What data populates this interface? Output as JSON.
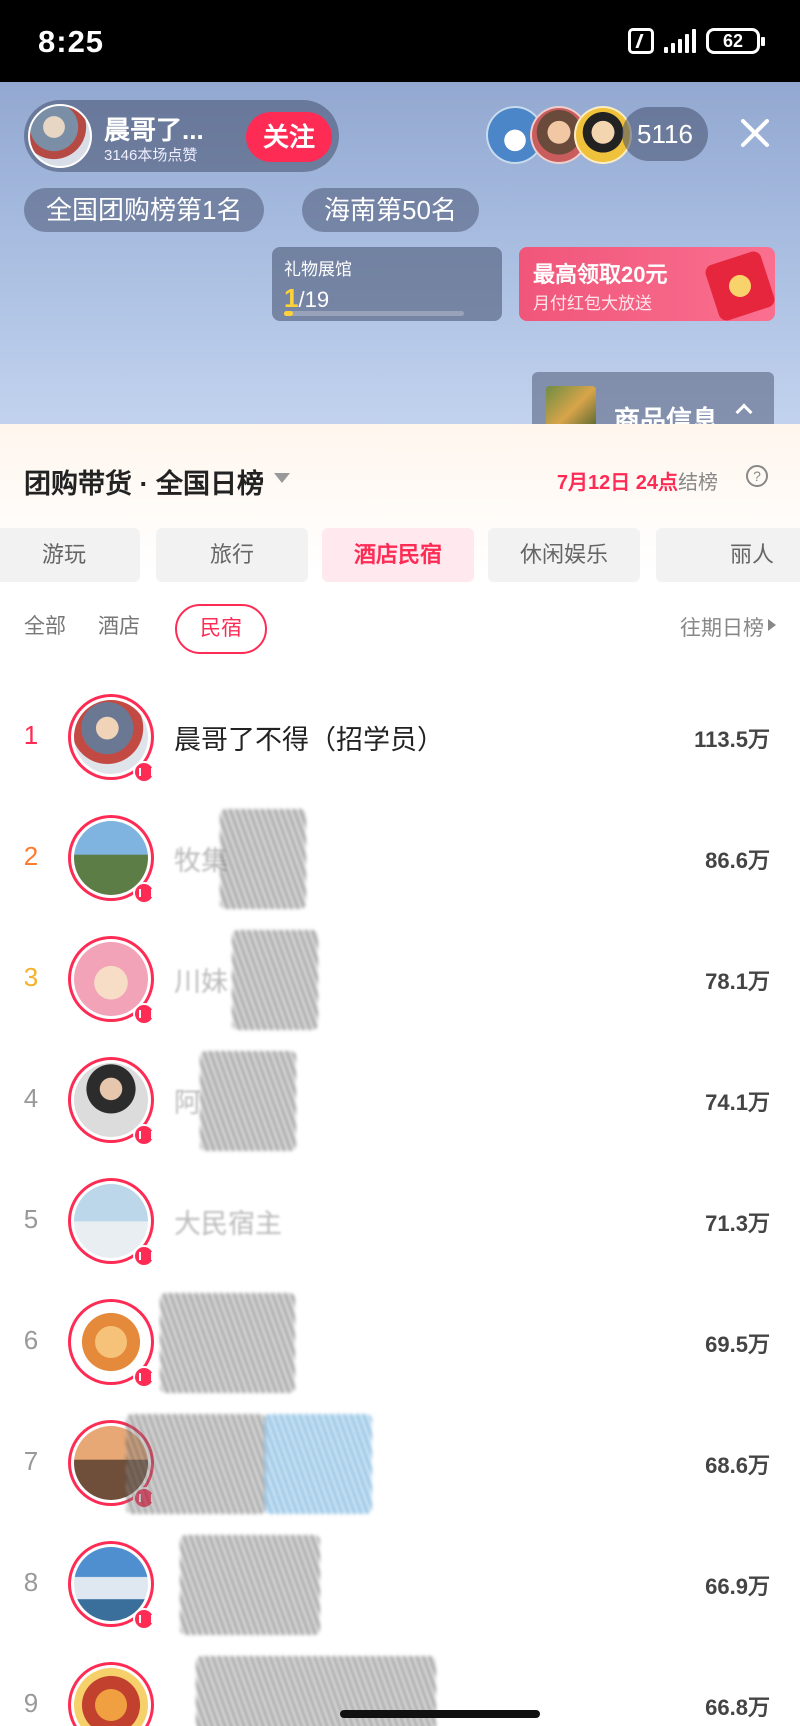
{
  "status_bar": {
    "time": "8:25",
    "battery": "62"
  },
  "live": {
    "host": {
      "name": "晨哥了...",
      "likes": "3146本场点赞",
      "follow_label": "关注"
    },
    "viewer_count": "5116",
    "badges": {
      "national": "全国团购榜第1名",
      "hainan": "海南第50名"
    },
    "gift": {
      "title": "礼物展馆",
      "current": "1",
      "total": "/19",
      "progress": 0.0526
    },
    "promo": {
      "title": "最高领取20元",
      "subtitle": "月付红包大放送"
    },
    "product_label": "商品信息"
  },
  "ranking": {
    "title": "团购带货 · 全国日榜",
    "settle_time": "7月12日 24点",
    "settle_label": "结榜",
    "help_label": "?",
    "tabs": [
      {
        "label": "游玩"
      },
      {
        "label": "旅行"
      },
      {
        "label": "酒店民宿"
      },
      {
        "label": "休闲娱乐"
      },
      {
        "label": "丽人"
      }
    ],
    "active_tab": "酒店民宿",
    "sub_filters": [
      {
        "label": "全部"
      },
      {
        "label": "酒店"
      },
      {
        "label": "民宿"
      }
    ],
    "active_sub_filter": "民宿",
    "history_label": "往期日榜",
    "rows": [
      {
        "rank": "1",
        "name": "晨哥了不得（招学员）",
        "score": "113.5万"
      },
      {
        "rank": "2",
        "name": "牧集",
        "score": "86.6万"
      },
      {
        "rank": "3",
        "name": "川妹",
        "score": "78.1万"
      },
      {
        "rank": "4",
        "name": "阿",
        "score": "74.1万"
      },
      {
        "rank": "5",
        "name": "大民宿主",
        "score": "71.3万"
      },
      {
        "rank": "6",
        "name": "",
        "score": "69.5万"
      },
      {
        "rank": "7",
        "name": "",
        "score": "68.6万"
      },
      {
        "rank": "8",
        "name": "",
        "score": "66.9万"
      },
      {
        "rank": "9",
        "name": "",
        "score": "66.8万"
      }
    ]
  }
}
